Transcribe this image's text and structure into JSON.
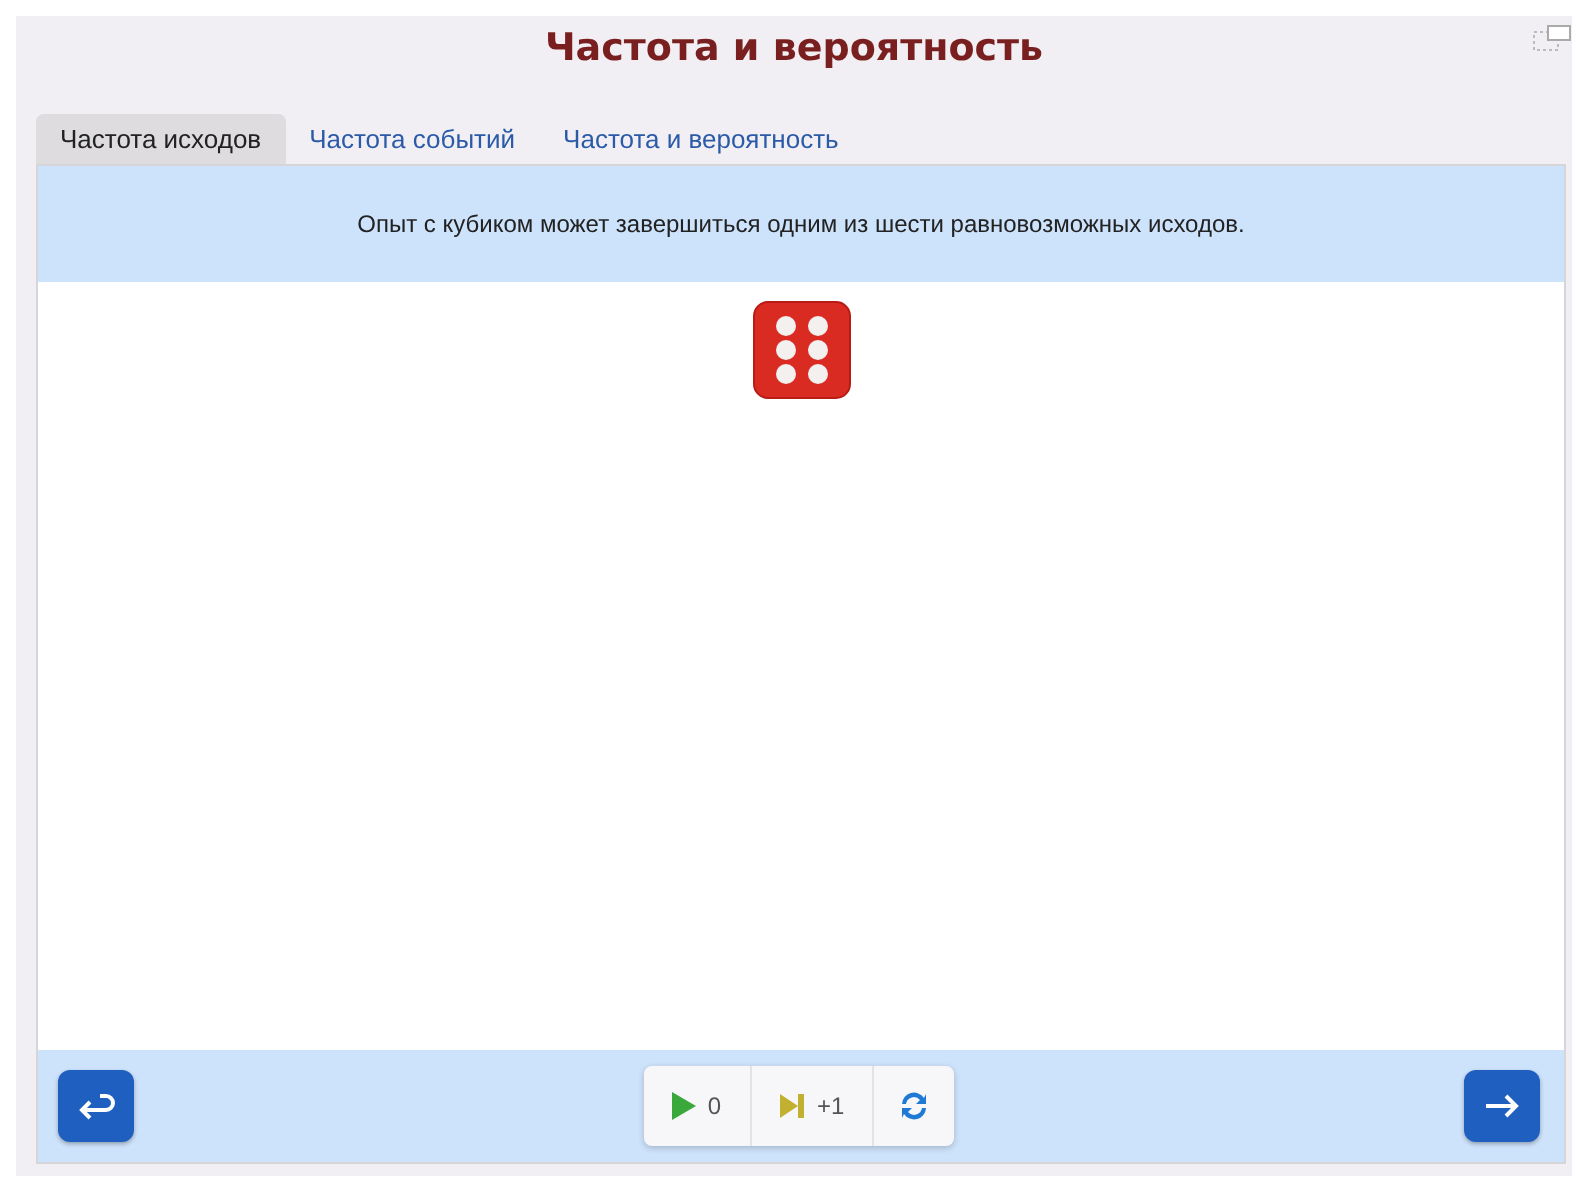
{
  "title": "Частота и вероятность",
  "tabs": [
    {
      "label": "Частота исходов",
      "selected": true
    },
    {
      "label": "Частота событий",
      "selected": false
    },
    {
      "label": "Частота и вероятность",
      "selected": false
    }
  ],
  "info": "Опыт с кубиком может завершиться одним из шести равновозможных исходов.",
  "controls": {
    "play_count": "0",
    "step_label": "+1"
  }
}
